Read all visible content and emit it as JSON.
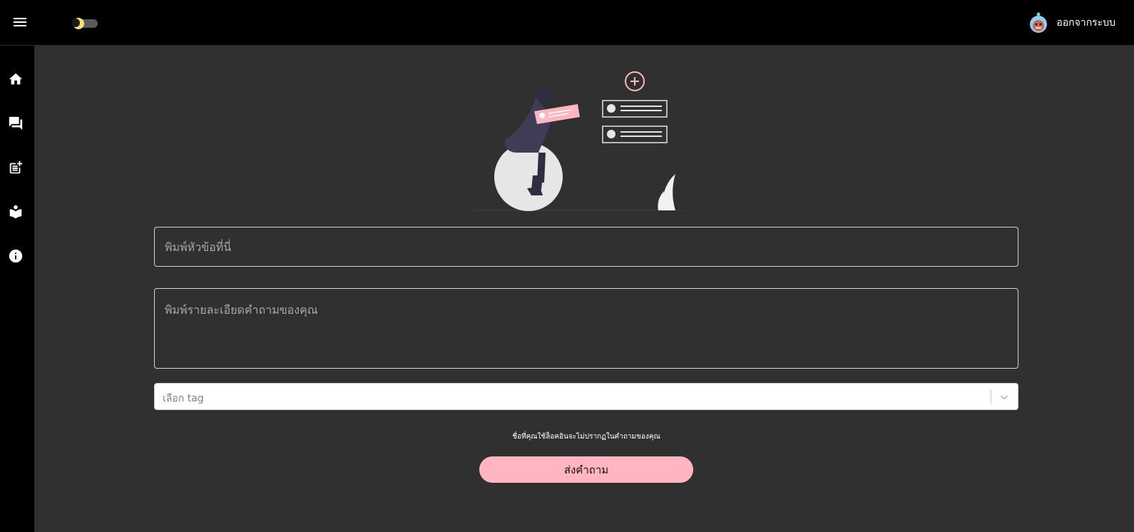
{
  "header": {
    "logout_label": "ออกจากระบบ"
  },
  "sidebar": {
    "items": [
      {
        "icon": "home-icon"
      },
      {
        "icon": "forum-icon"
      },
      {
        "icon": "post-add-icon"
      },
      {
        "icon": "reading-icon"
      },
      {
        "icon": "info-icon"
      }
    ]
  },
  "form": {
    "title_placeholder": "พิมพ์หัวข้อที่นี่",
    "description_placeholder": "พิมพ์รายละเอียดคำถามของคุณ",
    "tag_placeholder": "เลือก tag",
    "notice": "ชื่อที่คุณใช้ล็อคอินจะไม่ปรากฏในคำถามของคุณ",
    "submit_label": "ส่งคำถาม"
  },
  "colors": {
    "accent": "#ffb6c1",
    "background": "#303030",
    "bar": "#000000"
  }
}
